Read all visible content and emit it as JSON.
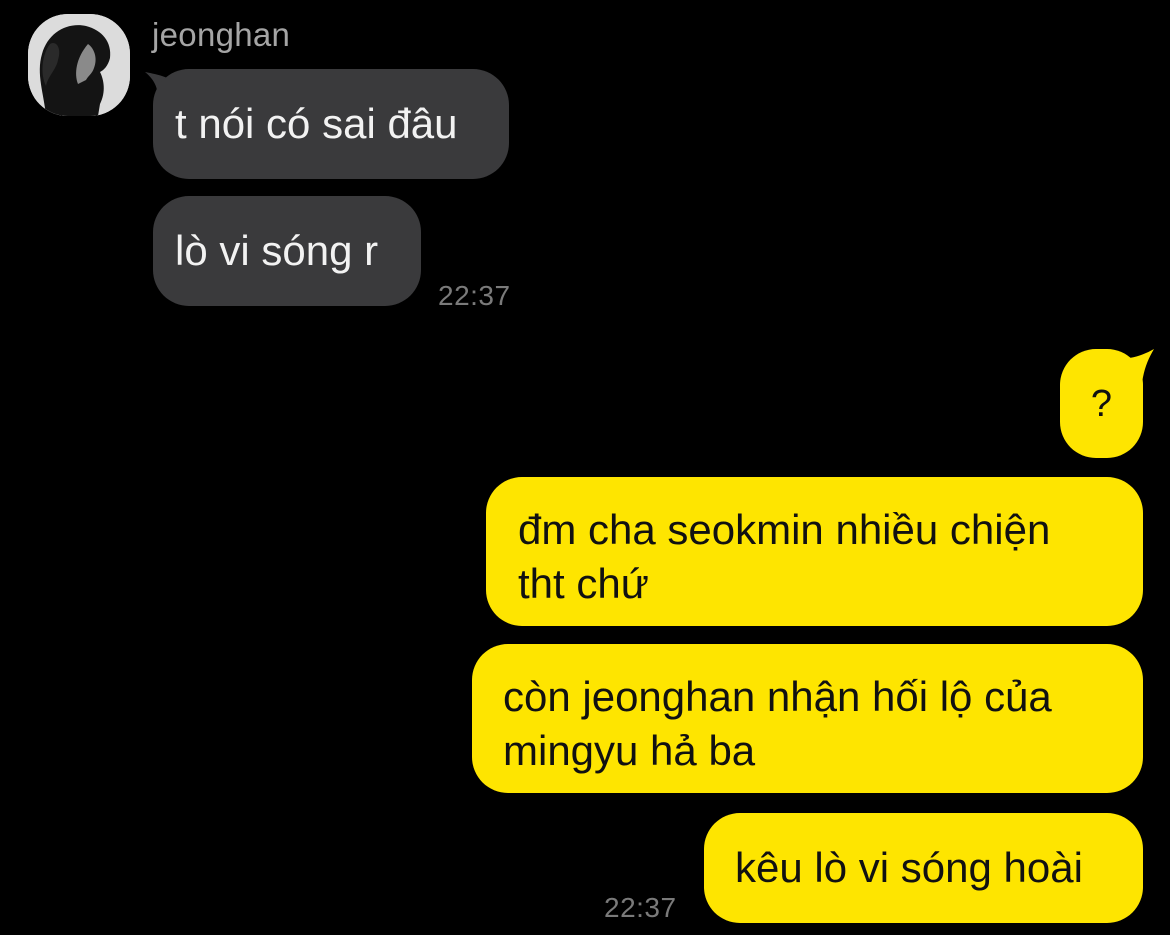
{
  "contact": {
    "name": "jeonghan",
    "avatar_icon": "profile-photo"
  },
  "incoming": [
    {
      "text": "t nói có sai đâu"
    },
    {
      "text": "lò vi sóng r"
    }
  ],
  "incoming_time": "22:37",
  "outgoing": [
    {
      "text": "?"
    },
    {
      "line1": "đm cha seokmin nhiều chiện",
      "line2": "tht chứ"
    },
    {
      "line1": "còn jeonghan nhận hối lộ của",
      "line2": "mingyu hả ba"
    },
    {
      "text": "kêu lò vi sóng hoài"
    }
  ],
  "outgoing_time": "22:37",
  "colors": {
    "background": "#000000",
    "incoming_bubble": "#3a3a3c",
    "outgoing_bubble": "#fee500",
    "timestamp": "#7a7a7a"
  }
}
